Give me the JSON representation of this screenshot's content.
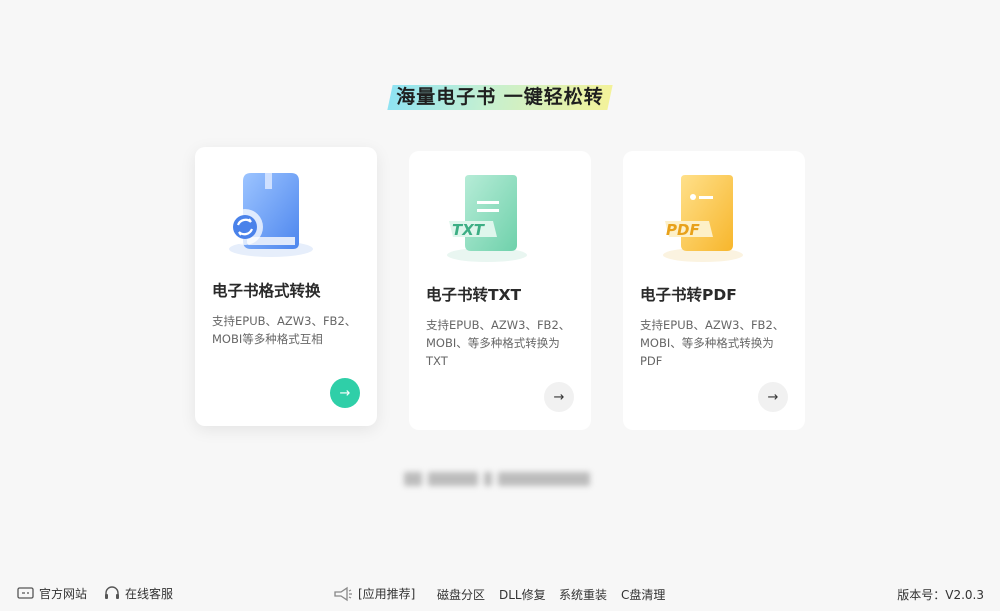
{
  "headline": "海量电子书  一键轻松转",
  "cards": [
    {
      "title": "电子书格式转换",
      "description": "支持EPUB、AZW3、FB2、MOBI等多种格式互相",
      "arrow": "→",
      "icon": "ebook-convert-icon"
    },
    {
      "title": "电子书转TXT",
      "description": "支持EPUB、AZW3、FB2、MOBI、等多种格式转换为TXT",
      "arrow": "→",
      "icon": "txt-file-icon",
      "icon_label": "TXT"
    },
    {
      "title": "电子书转PDF",
      "description": "支持EPUB、AZW3、FB2、MOBI、等多种格式转换为PDF",
      "arrow": "→",
      "icon": "pdf-file-icon",
      "icon_label": "PDF"
    }
  ],
  "footer": {
    "official_site": "官方网站",
    "online_service": "在线客服",
    "app_recommend": "[应用推荐]",
    "links": [
      "磁盘分区",
      "DLL修复",
      "系统重装",
      "C盘清理"
    ],
    "version": "版本号：V2.0.3"
  },
  "colors": {
    "accent": "#2fcfa8",
    "book_blue": "#6aa3f7",
    "txt_green": "#7ad8b6",
    "pdf_yellow": "#f8c84c"
  }
}
